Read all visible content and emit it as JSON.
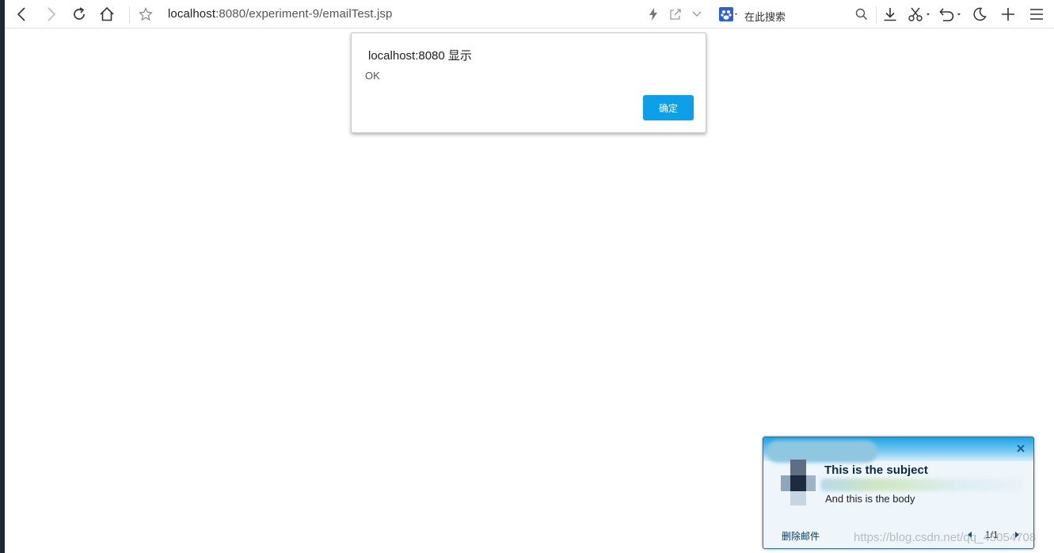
{
  "browser": {
    "url_host": "localhost",
    "url_rest": ":8080/experiment-9/emailTest.jsp",
    "search_placeholder": "在此搜索"
  },
  "dialog": {
    "title": "localhost:8080 显示",
    "message": "OK",
    "ok_label": "确定",
    "ok_color": "#0ca0ea"
  },
  "notification": {
    "subject": "This is the subject",
    "body": "And this is the body",
    "delete_label": "删除邮件",
    "page": "1/1"
  },
  "watermark": "https://blog.csdn.net/qq_45054708"
}
